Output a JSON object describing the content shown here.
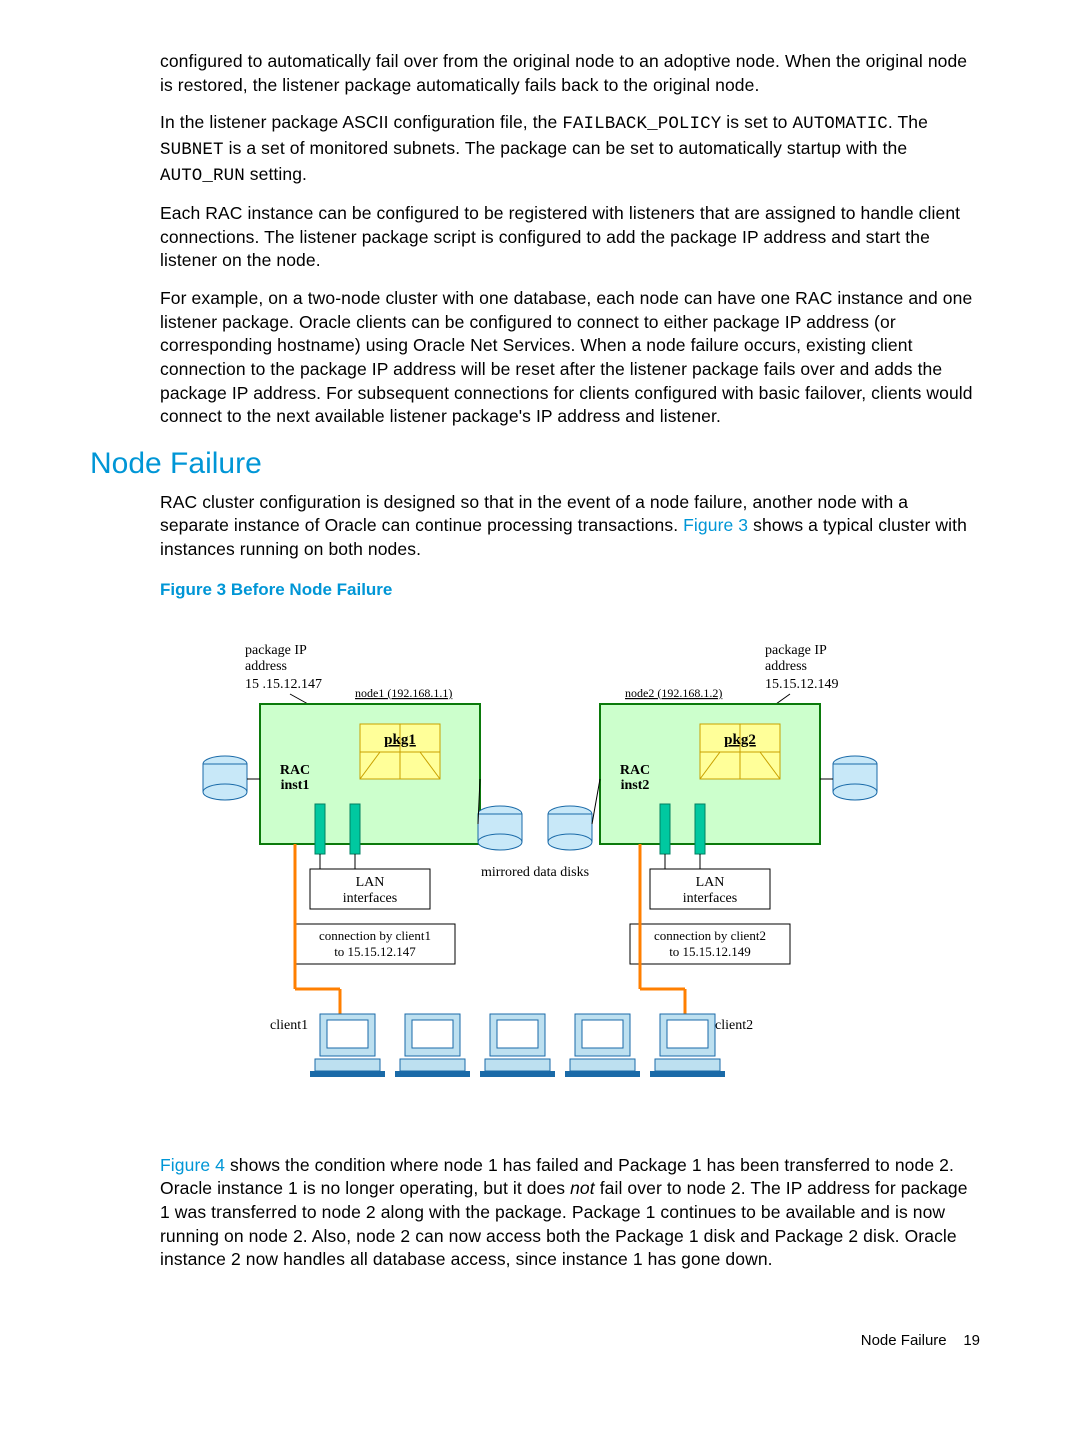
{
  "paragraphs": {
    "p1": "configured to automatically fail over from the original node to an adoptive node. When the original node is restored, the listener package automatically fails back to the original node.",
    "p2a": "In the listener package ASCII configuration file, the ",
    "p2_code1": "FAILBACK_POLICY",
    "p2b": " is set to ",
    "p2_code2": "AUTOMATIC",
    "p2c": ". The ",
    "p2_code3": "SUBNET",
    "p2d": " is a set of monitored subnets. The package can be set to automatically startup with the ",
    "p2_code4": "AUTO_RUN",
    "p2e": " setting.",
    "p3": "Each RAC instance can be configured to be registered with listeners that are assigned to handle client connections. The listener package script is configured to add the package IP address and start the listener on the node.",
    "p4": "For example, on a two-node cluster with one database, each node can have one RAC instance and one listener package. Oracle clients can be configured to connect to either package IP address (or corresponding hostname) using Oracle Net Services. When a node failure occurs, existing client connection to the package IP address will be reset after the listener package fails over and adds the package IP address. For subsequent connections for clients configured with basic failover, clients would connect to the next available listener package's IP address and listener."
  },
  "heading": "Node Failure",
  "section_para_a": "RAC cluster configuration is designed so that in the event of a node failure, another node with a separate instance of Oracle can continue processing transactions. ",
  "section_link1": "Figure 3",
  "section_para_b": " shows a typical cluster with instances running on both nodes.",
  "figure_caption": "Figure 3 Before Node Failure",
  "figure": {
    "pkg_ip_label": "package IP",
    "address_label": "address",
    "ip1": "15 .15.12.147",
    "ip2": "15.15.12.149",
    "node1_label": "node1 (192.168.1.1)",
    "node2_label": "node2 (192.168.1.2)",
    "pkg1": "pkg1",
    "pkg2": "pkg2",
    "rac1a": "RAC",
    "rac1b": "inst1",
    "rac2a": "RAC",
    "rac2b": "inst2",
    "mirrored": "mirrored data disks",
    "lan": "LAN",
    "interfaces": "interfaces",
    "conn1a": "connection by client1",
    "conn1b": "to  15.15.12.147",
    "conn2a": "connection by client2",
    "conn2b": "to  15.15.12.149",
    "client1": "client1",
    "client2": "client2"
  },
  "after_para_link": "Figure 4",
  "after_para_a": " shows the condition where node 1 has failed and Package 1 has been transferred to node 2. Oracle instance 1 is no longer operating, but it does ",
  "after_para_italic": "not",
  "after_para_b": " fail over to node 2. The IP address for package 1 was transferred to node 2 along with the package. Package 1 continues to be available and is now running on node 2. Also, node 2 can now access both the Package 1 disk and Package 2 disk. Oracle instance 2 now handles all database access, since instance 1 has gone down.",
  "footer_text": "Node Failure",
  "footer_page": "19"
}
